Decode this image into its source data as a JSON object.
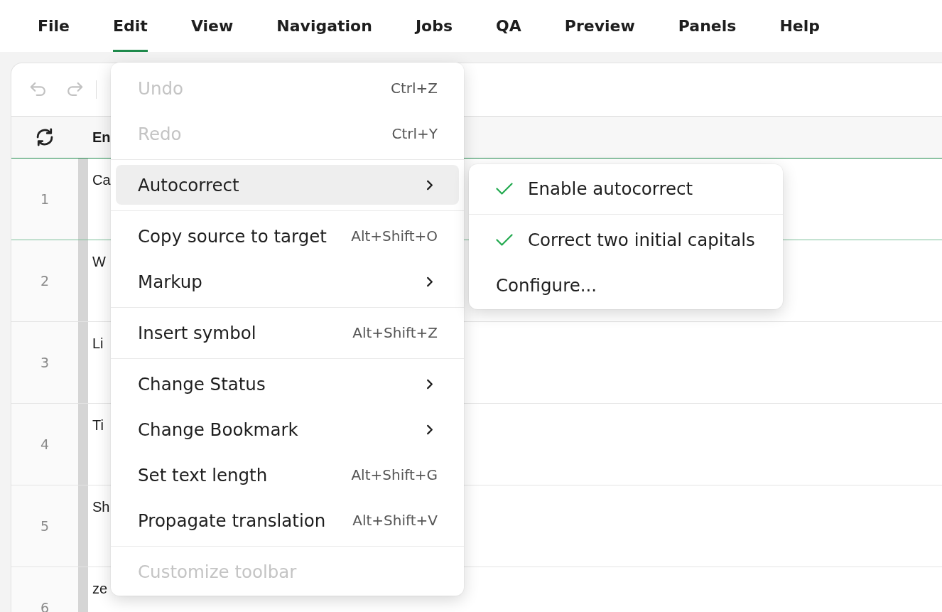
{
  "menu_bar": [
    {
      "label": "File",
      "selected": false
    },
    {
      "label": "Edit",
      "selected": true
    },
    {
      "label": "View",
      "selected": false
    },
    {
      "label": "Navigation",
      "selected": false
    },
    {
      "label": "Jobs",
      "selected": false
    },
    {
      "label": "QA",
      "selected": false
    },
    {
      "label": "Preview",
      "selected": false
    },
    {
      "label": "Panels",
      "selected": false
    },
    {
      "label": "Help",
      "selected": false
    }
  ],
  "toolbar": {
    "buttons": [
      {
        "kind": "undo",
        "disabled": true
      },
      {
        "kind": "redo",
        "disabled": true
      }
    ]
  },
  "grid": {
    "header_label": "En",
    "rows": [
      {
        "number": "1",
        "text": "Ca",
        "selected": true
      },
      {
        "number": "2",
        "text": "W",
        "selected": false
      },
      {
        "number": "3",
        "text": "Li",
        "selected": false
      },
      {
        "number": "4",
        "text": "Ti",
        "selected": false
      },
      {
        "number": "5",
        "text": "Sh",
        "selected": false
      },
      {
        "number": "6",
        "text": "ze",
        "selected": false
      }
    ]
  },
  "edit_menu": {
    "sections": [
      {
        "items": [
          {
            "kind": "command",
            "label": "Undo",
            "shortcut": "Ctrl+Z",
            "disabled": true,
            "selected": false
          },
          {
            "kind": "command",
            "label": "Redo",
            "shortcut": "Ctrl+Y",
            "disabled": true,
            "selected": false
          }
        ]
      },
      {
        "items": [
          {
            "kind": "submenu",
            "label": "Autocorrect",
            "disabled": false,
            "selected": true
          }
        ]
      },
      {
        "items": [
          {
            "kind": "command",
            "label": "Copy source to target",
            "shortcut": "Alt+Shift+O",
            "disabled": false,
            "selected": false
          },
          {
            "kind": "submenu",
            "label": "Markup",
            "disabled": false,
            "selected": false
          }
        ]
      },
      {
        "items": [
          {
            "kind": "command",
            "label": "Insert symbol",
            "shortcut": "Alt+Shift+Z",
            "disabled": false,
            "selected": false
          }
        ]
      },
      {
        "items": [
          {
            "kind": "submenu",
            "label": "Change Status",
            "disabled": false,
            "selected": false
          },
          {
            "kind": "submenu",
            "label": "Change Bookmark",
            "disabled": false,
            "selected": false
          },
          {
            "kind": "command",
            "label": "Set text length",
            "shortcut": "Alt+Shift+G",
            "disabled": false,
            "selected": false
          },
          {
            "kind": "command",
            "label": "Propagate translation",
            "shortcut": "Alt+Shift+V",
            "disabled": false,
            "selected": false
          }
        ]
      },
      {
        "items": [
          {
            "kind": "command",
            "label": "Customize toolbar",
            "disabled": true,
            "selected": false
          }
        ]
      }
    ]
  },
  "autocorrect_submenu": {
    "sections": [
      {
        "items": [
          {
            "kind": "toggle",
            "label": "Enable autocorrect",
            "checked": true
          }
        ]
      },
      {
        "items": [
          {
            "kind": "toggle",
            "label": "Correct two initial capitals",
            "checked": true
          },
          {
            "kind": "action",
            "label": "Configure..."
          }
        ]
      }
    ]
  }
}
